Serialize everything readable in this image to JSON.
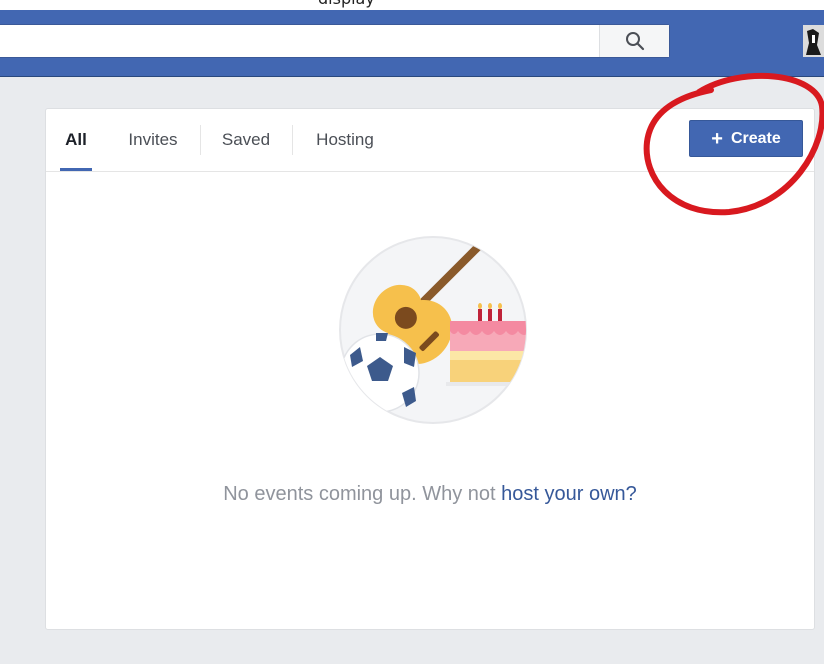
{
  "caption": {
    "text": "display"
  },
  "header": {
    "search_value": "",
    "search_icon": "search-icon",
    "avatar_icon": "profile-avatar"
  },
  "tabs": [
    {
      "label": "All",
      "active": true
    },
    {
      "label": "Invites",
      "active": false
    },
    {
      "label": "Saved",
      "active": false
    },
    {
      "label": "Hosting",
      "active": false
    }
  ],
  "actions": {
    "create_label": "Create",
    "create_icon": "plus-icon"
  },
  "empty_state": {
    "text": "No events coming up. Why not ",
    "link": "host your own?",
    "illustration": "events-illustration"
  },
  "colors": {
    "brand": "#4267b2",
    "page_bg": "#e9ebee",
    "muted_text": "#90949c",
    "link": "#365899",
    "annotation": "#d8191f"
  }
}
